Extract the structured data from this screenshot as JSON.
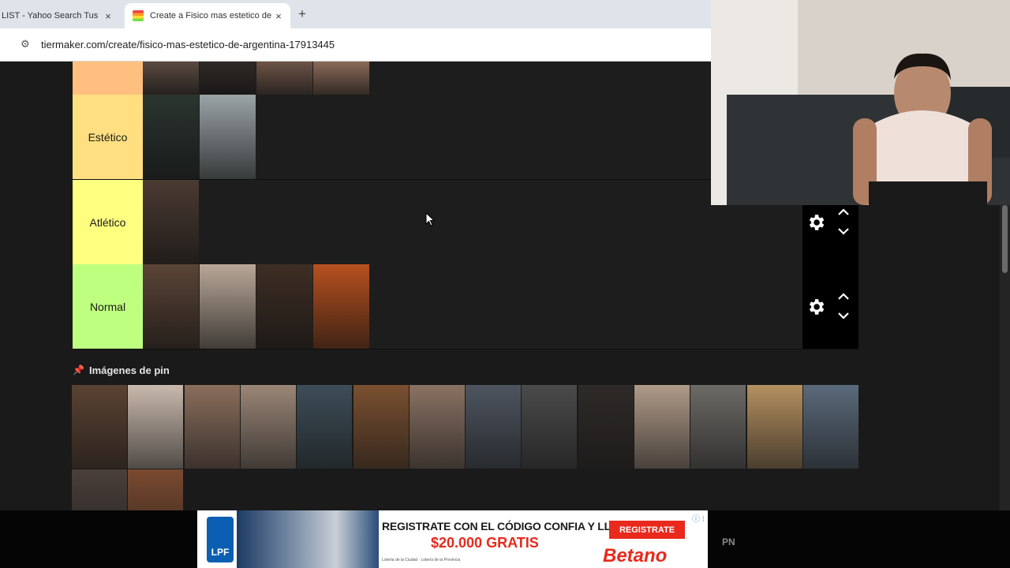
{
  "browser": {
    "tabs": [
      {
        "title": "LIST - Yahoo Search Tus re",
        "active": false,
        "close": "×"
      },
      {
        "title": "Create a Fisico mas estetico de",
        "active": true,
        "close": "×"
      }
    ],
    "new_tab": "+",
    "url": "tiermaker.com/create/fisico-mas-estetico-de-argentina-17913445"
  },
  "tiers": [
    {
      "label": "",
      "color": "#ffbf7f",
      "thumbs": [
        "#5a4a40",
        "#2f2a27",
        "#6d5448",
        "#8a6a58"
      ],
      "controls": false
    },
    {
      "label": "Estético",
      "color": "#ffdf7f",
      "thumbs": [
        "#2b3530",
        "#9aa3a6"
      ],
      "controls": false
    },
    {
      "label": "Atlético",
      "color": "#ffff7f",
      "thumbs": [
        "#4a3a32"
      ],
      "controls": true
    },
    {
      "label": "Normal",
      "color": "#bfff7f",
      "thumbs": [
        "#5a4436",
        "#b9a898",
        "#3e2e24",
        "#b8501f"
      ],
      "controls": true
    }
  ],
  "pin_section": {
    "icon": "📌",
    "title": "Imágenes de pin",
    "thumbs": [
      "#5a4232",
      "#c9b9ad",
      "#8a6e5c",
      "#9a8676",
      "#3d4d57",
      "#7a5030",
      "#8a7262",
      "#4e5560",
      "#4a4a4a",
      "#2e2a28",
      "#b09a88",
      "#6c6a66",
      "#b59060",
      "#5a6a7a",
      "#4a3f3a",
      "#7a4a30"
    ]
  },
  "ad": {
    "league": "LPF",
    "headline": "REGISTRATE CON EL CÓDIGO CONFIA Y LLEVATE",
    "amount": "$20.000 GRATIS",
    "legal": "Lotería de la Ciudad · Lotería de la Provincia",
    "cta": "REGISTRATE",
    "brand": "Betano",
    "info": "ⓘ ⁝"
  },
  "pn_label": "PN"
}
